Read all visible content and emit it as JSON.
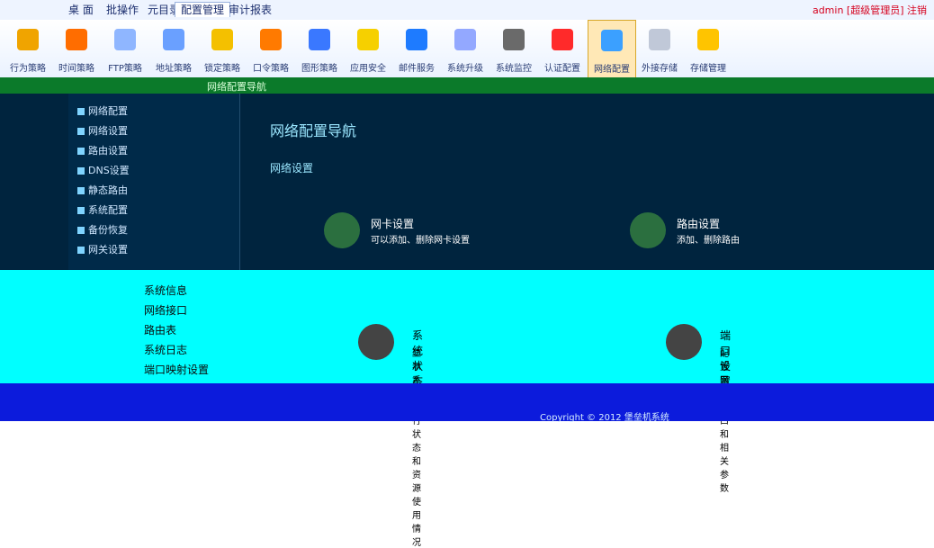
{
  "top_menu": {
    "items": [
      "桌 面",
      "批操作",
      "元目录",
      "配置管理",
      "审计报表"
    ],
    "active_index": 3,
    "user": "admin [超级管理员] 注销"
  },
  "toolbar": {
    "items": [
      {
        "label": "行为策略",
        "icon": "behavior-icon",
        "color": "#f0a400"
      },
      {
        "label": "时间策略",
        "icon": "clock-icon",
        "color": "#ff6d00"
      },
      {
        "label": "FTP策略",
        "icon": "ftp-icon",
        "color": "#8fb6ff"
      },
      {
        "label": "地址策略",
        "icon": "address-icon",
        "color": "#6aa0ff"
      },
      {
        "label": "锁定策略",
        "icon": "lock-icon",
        "color": "#f4c000"
      },
      {
        "label": "口令策略",
        "icon": "key-icon",
        "color": "#ff7a00"
      },
      {
        "label": "图形策略",
        "icon": "graphic-icon",
        "color": "#3a78ff"
      },
      {
        "label": "应用安全",
        "icon": "app-security-icon",
        "color": "#f6d000"
      },
      {
        "label": "邮件服务",
        "icon": "mail-icon",
        "color": "#1e7bff"
      },
      {
        "label": "系统升级",
        "icon": "upgrade-icon",
        "color": "#93a8ff"
      },
      {
        "label": "系统监控",
        "icon": "monitor-icon",
        "color": "#6a6a6a"
      },
      {
        "label": "认证配置",
        "icon": "auth-icon",
        "color": "#ff2a2a"
      },
      {
        "label": "网络配置",
        "icon": "network-icon",
        "color": "#3ba0ff"
      },
      {
        "label": "外接存储",
        "icon": "storage-icon",
        "color": "#c0c8d8"
      },
      {
        "label": "存储管理",
        "icon": "storage-manage-icon",
        "color": "#ffc400"
      }
    ],
    "selected_index": 12
  },
  "green_bar": {
    "title": "网络配置导航"
  },
  "sidebar": {
    "items": [
      "网络配置",
      "网络设置",
      "路由设置",
      "DNS设置",
      "静态路由",
      "系统配置",
      "备份恢复",
      "网关设置"
    ]
  },
  "main": {
    "title": "网络配置导航",
    "subtitle": "网络设置",
    "cards": [
      {
        "title": "网卡设置",
        "desc": "可以添加、删除网卡设置"
      },
      {
        "title": "路由设置",
        "desc": "添加、删除路由"
      }
    ]
  },
  "cyan_area": {
    "list": [
      "系统信息",
      "网络接口",
      "路由表",
      "系统日志",
      "端口映射设置"
    ],
    "blocks": [
      {
        "title": "系统状态",
        "desc": "显示系统运行状态和资源使用情况"
      },
      {
        "title": "端口设置",
        "desc": "配置网络端口和相关参数"
      }
    ]
  },
  "footer": {
    "text": "Copyright © 2012 堡垒机系统"
  }
}
